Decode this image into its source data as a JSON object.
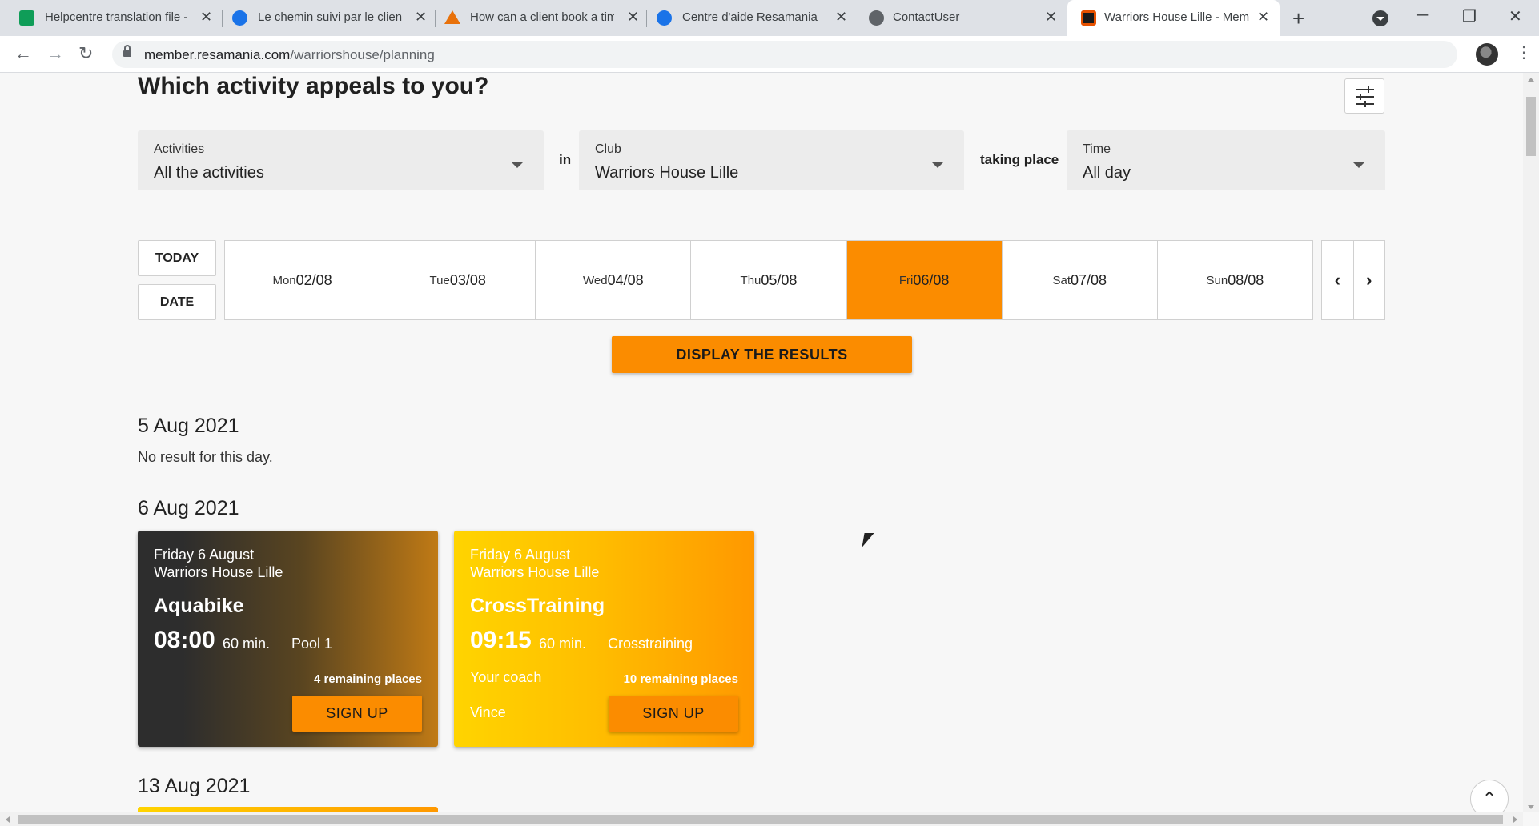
{
  "browser": {
    "tabs": [
      {
        "title": "Helpcentre translation file -",
        "icon": "sheets-icon",
        "color": "#0f9d58"
      },
      {
        "title": "Le chemin suivi par le client",
        "icon": "resamania-icon",
        "color": "#1a73e8"
      },
      {
        "title": "How can a client book a tim",
        "icon": "help-article-icon",
        "color": "#e8710a"
      },
      {
        "title": "Centre d'aide Resamania",
        "icon": "resamania-icon",
        "color": "#1a73e8"
      },
      {
        "title": "ContactUser",
        "icon": "gear-favicon-icon",
        "color": "#5f6368"
      },
      {
        "title": "Warriors House Lille - Mem",
        "icon": "warriors-icon",
        "color": "#e65100"
      }
    ],
    "active_tab": 5,
    "url_host": "member.resamania.com",
    "url_path": "/warriorshouse/planning"
  },
  "page": {
    "heading": "Which activity appeals to you?",
    "filters": {
      "activities": {
        "label": "Activities",
        "value": "All the activities"
      },
      "in_label": "in",
      "club": {
        "label": "Club",
        "value": "Warriors House Lille"
      },
      "taking_place_label": "taking place",
      "time": {
        "label": "Time",
        "value": "All day"
      }
    },
    "today_label": "TODAY",
    "date_label": "DATE",
    "days": [
      {
        "name": "Mon",
        "date": "02/08"
      },
      {
        "name": "Tue",
        "date": "03/08"
      },
      {
        "name": "Wed",
        "date": "04/08"
      },
      {
        "name": "Thu",
        "date": "05/08"
      },
      {
        "name": "Fri",
        "date": "06/08"
      },
      {
        "name": "Sat",
        "date": "07/08"
      },
      {
        "name": "Sun",
        "date": "08/08"
      }
    ],
    "selected_day_index": 4,
    "display_results_label": "DISPLAY THE RESULTS",
    "sections": [
      {
        "title": "5 Aug 2021",
        "no_result": "No result for this day."
      },
      {
        "title": "6 Aug 2021"
      },
      {
        "title": "13 Aug 2021"
      }
    ],
    "cards": [
      {
        "date": "Friday 6 August",
        "club": "Warriors House Lille",
        "activity": "Aquabike",
        "time": "08:00",
        "duration": "60 min.",
        "room": "Pool 1",
        "coach_label": "",
        "coach": "",
        "places": "4 remaining places",
        "signup": "SIGN UP"
      },
      {
        "date": "Friday 6 August",
        "club": "Warriors House Lille",
        "activity": "CrossTraining",
        "time": "09:15",
        "duration": "60 min.",
        "room": "Crosstraining",
        "coach_label": "Your coach",
        "coach": "Vince",
        "places": "10 remaining places",
        "signup": "SIGN UP"
      }
    ],
    "accent_color": "#fb8c00"
  }
}
